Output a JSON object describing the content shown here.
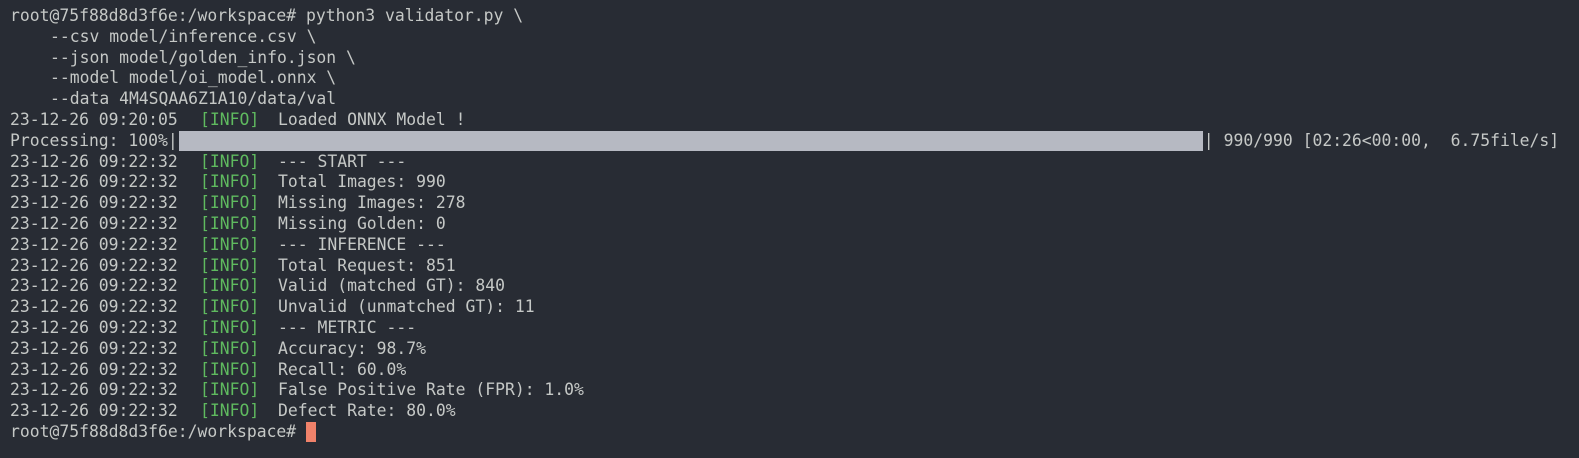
{
  "command": {
    "prompt": "root@75f88d8d3f6e:/workspace#",
    "cmd": "python3 validator.py \\",
    "args": [
      "--csv model/inference.csv \\",
      "--json model/golden_info.json \\",
      "--model model/oi_model.onnx \\",
      "--data 4M4SQAA6Z1A10/data/val"
    ]
  },
  "load_line": {
    "timestamp": "23-12-26 09:20:05",
    "level": "[INFO]",
    "message": "Loaded ONNX Model !"
  },
  "progress": {
    "label": "Processing: 100%|",
    "end": "|",
    "stats": "990/990 [02:26<00:00,  6.75file/s]",
    "value": 1.0
  },
  "logs": [
    {
      "timestamp": "23-12-26 09:22:32",
      "level": "[INFO]",
      "message": "--- START ---"
    },
    {
      "timestamp": "23-12-26 09:22:32",
      "level": "[INFO]",
      "message": "Total Images: 990"
    },
    {
      "timestamp": "23-12-26 09:22:32",
      "level": "[INFO]",
      "message": "Missing Images: 278"
    },
    {
      "timestamp": "23-12-26 09:22:32",
      "level": "[INFO]",
      "message": "Missing Golden: 0"
    },
    {
      "timestamp": "23-12-26 09:22:32",
      "level": "[INFO]",
      "message": "--- INFERENCE ---"
    },
    {
      "timestamp": "23-12-26 09:22:32",
      "level": "[INFO]",
      "message": "Total Request: 851"
    },
    {
      "timestamp": "23-12-26 09:22:32",
      "level": "[INFO]",
      "message": "Valid (matched GT): 840"
    },
    {
      "timestamp": "23-12-26 09:22:32",
      "level": "[INFO]",
      "message": "Unvalid (unmatched GT): 11"
    },
    {
      "timestamp": "23-12-26 09:22:32",
      "level": "[INFO]",
      "message": "--- METRIC ---"
    },
    {
      "timestamp": "23-12-26 09:22:32",
      "level": "[INFO]",
      "message": "Accuracy: 98.7%"
    },
    {
      "timestamp": "23-12-26 09:22:32",
      "level": "[INFO]",
      "message": "Recall: 60.0%"
    },
    {
      "timestamp": "23-12-26 09:22:32",
      "level": "[INFO]",
      "message": "False Positive Rate (FPR): 1.0%"
    },
    {
      "timestamp": "23-12-26 09:22:32",
      "level": "[INFO]",
      "message": "Defect Rate: 80.0%"
    }
  ],
  "final_prompt": "root@75f88d8d3f6e:/workspace#",
  "colors": {
    "background": "#282c34",
    "text": "#c5c8c6",
    "info": "#5fba5f",
    "progress_fill": "#b6b9c2",
    "cursor": "#f0826a"
  }
}
